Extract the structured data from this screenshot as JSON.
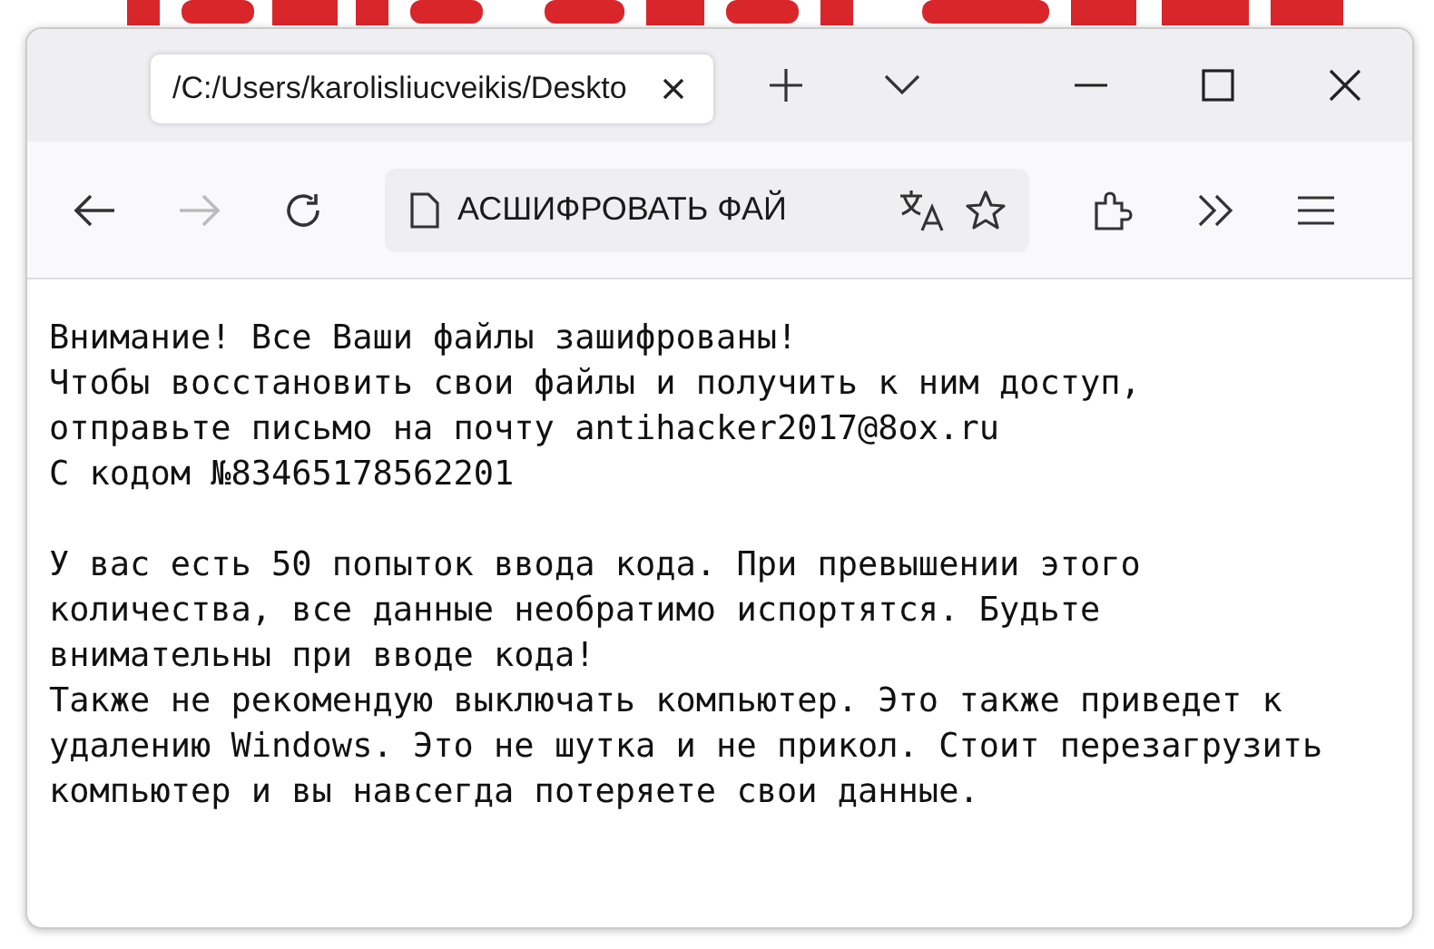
{
  "window": {
    "tab": {
      "title": "/C:/Users/karolisliucveikis/Deskto",
      "selected": true
    },
    "toolbar": {
      "address": "АСШИФРОВАТЬ ФАЙ",
      "forward_disabled": true
    }
  },
  "note": {
    "paragraphs": [
      "Внимание! Все Ваши файлы зашифрованы!\nЧтобы восстановить свои файлы и получить к ним доступ,\nотправьте письмо на почту antihacker2017@8ox.ru\nС кодом №83465178562201",
      "У вас есть 50 попыток ввода кода. При превышении этого\nколичества, все данные необратимо испортятся. Будьте\nвнимательны при вводе кода!\nТакже не рекомендую выключать компьютер. Это также приведет к\nудалению Windows. Это не шутка и не прикол. Стоит перезагрузить\nкомпьютер и вы навсегда потеряете свои данные."
    ]
  }
}
